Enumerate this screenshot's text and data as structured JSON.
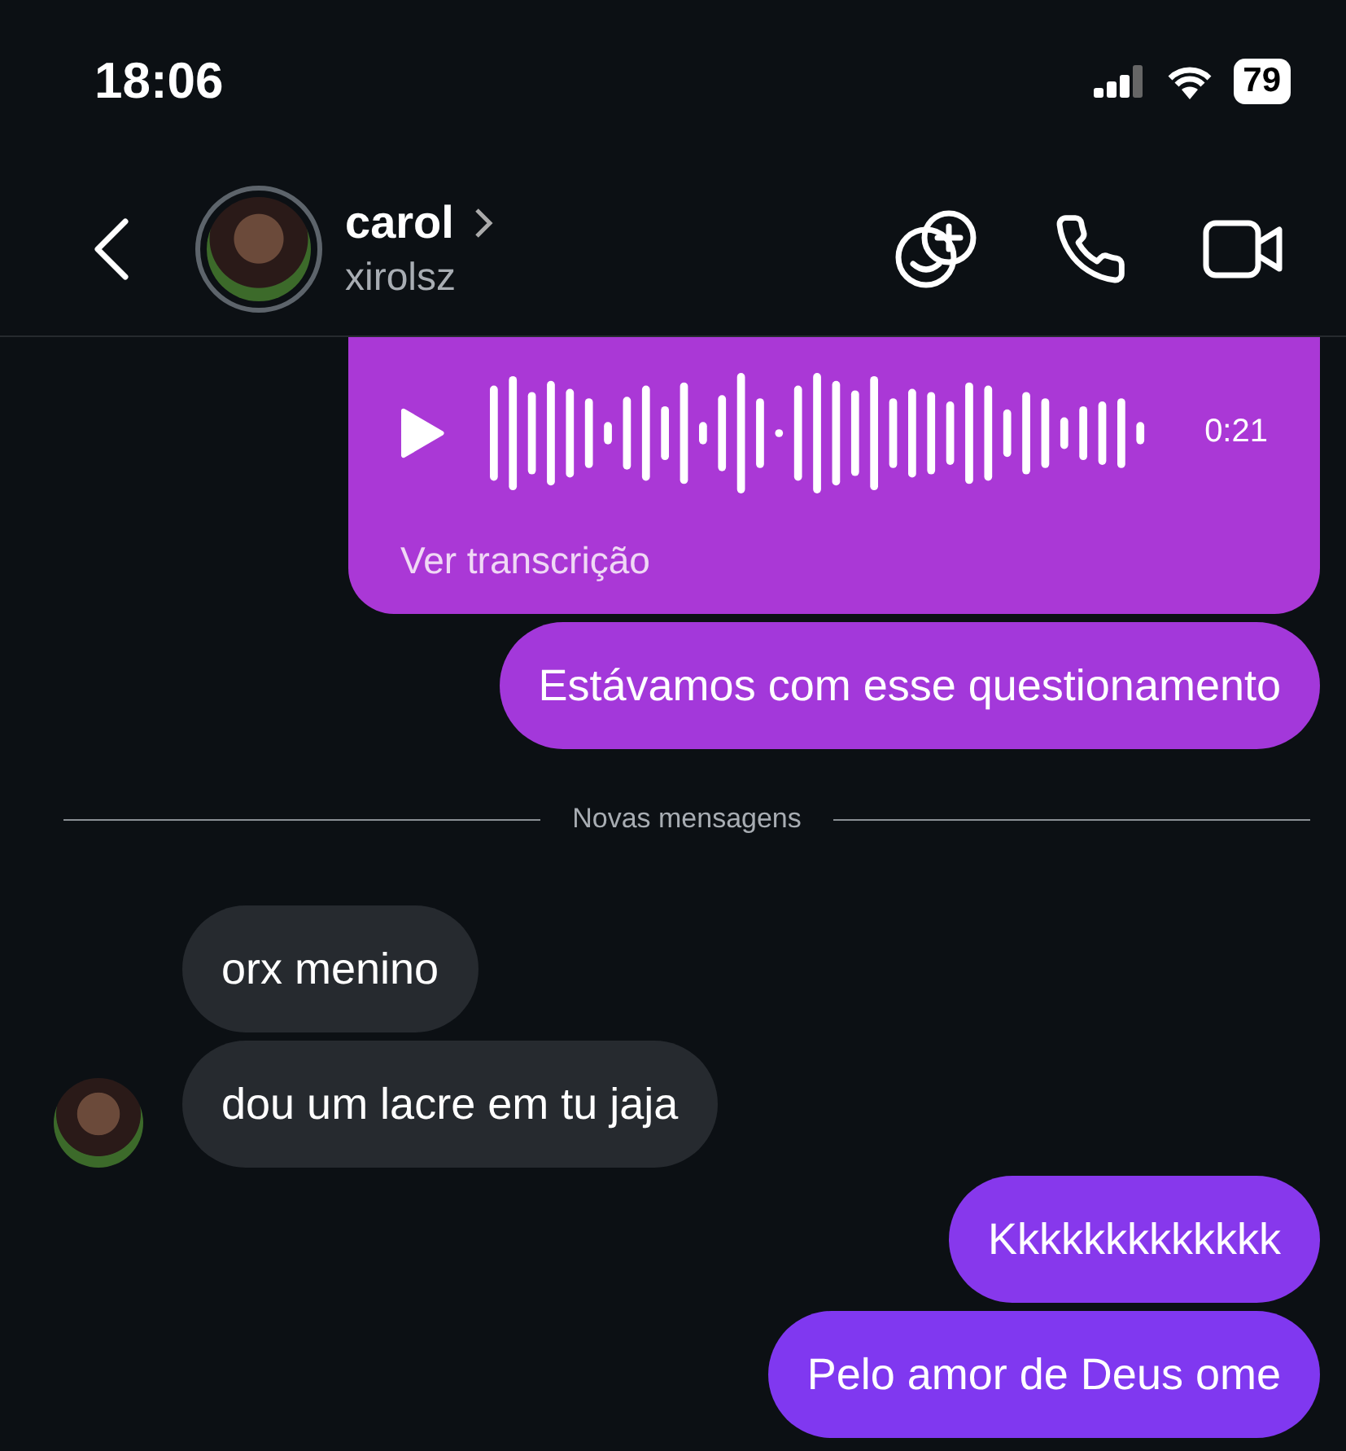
{
  "status_bar": {
    "time": "18:06",
    "battery": "79"
  },
  "header": {
    "name": "carol",
    "username": "xirolsz"
  },
  "messages": [
    {
      "kind": "audio",
      "outgoing": true,
      "duration": "0:21",
      "link": "Ver transcrição"
    },
    {
      "kind": "text",
      "outgoing": true,
      "text": "Estávamos com esse questionamento"
    },
    {
      "kind": "divider",
      "text": "Novas mensagens"
    },
    {
      "kind": "text",
      "outgoing": false,
      "text": "orx menino",
      "show_avatar": false
    },
    {
      "kind": "text",
      "outgoing": false,
      "text": "dou um lacre em tu jaja",
      "show_avatar": true
    },
    {
      "kind": "text",
      "outgoing": true,
      "text": "Kkkkkkkkkkkkk"
    },
    {
      "kind": "text",
      "outgoing": true,
      "text": "Pelo amor de Deus ome"
    }
  ]
}
